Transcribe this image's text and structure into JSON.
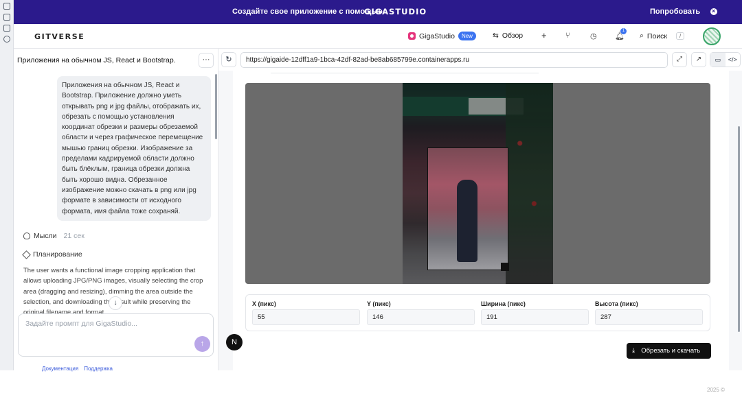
{
  "banner": {
    "message": "Создайте свое приложение с помощью",
    "brand": "GIGASTUDIO",
    "cta": "Попробовать"
  },
  "header": {
    "logo": "GITVERSE",
    "gigastudio": "GigaStudio",
    "new_badge": "New",
    "overview": "Обзор",
    "search": "Поиск",
    "search_shortcut": "/",
    "notifications_count": "1"
  },
  "chat": {
    "title": "Приложения на обычном JS, React и Bootstrap.",
    "user_message": "Приложения на обычном JS, React и Bootstrap. Приложение должно уметь открывать png и jpg файлы, отображать их, обрезать с помощью установления координат обрезки и размеры обрезаемой области и через графическое перемещение мышью границ обрезки. Изображение за пределами кадрируемой области должно быть блёклым, граница обрезки должна быть хорошо видна. Обрезанное изображение можно скачать в png или jpg формате в зависимости от исходного формата, имя файла тоже сохраняй.",
    "thoughts_label": "Мысли",
    "thoughts_time": "21 сек",
    "planning_label": "Планирование",
    "planning_text": "The user wants a functional image cropping application that allows uploading JPG/PNG images, visually selecting the crop area (dragging and resizing), dimming the area outside the selection, and downloading the result while preserving the original filename and format.",
    "prompt_placeholder": "Задайте промпт для GigaStudio...",
    "footer_docs": "Документация",
    "footer_support": "Поддержка"
  },
  "preview": {
    "url": "https://gigaide-12dff1a9-1bca-42df-82ad-be8ab685799e.containerapps.ru"
  },
  "app": {
    "fields": [
      {
        "label": "X (пикс)",
        "value": "55"
      },
      {
        "label": "Y (пикс)",
        "value": "146"
      },
      {
        "label": "Ширина (пикс)",
        "value": "191"
      },
      {
        "label": "Высота (пикс)",
        "value": "287"
      }
    ],
    "download_label": "Обрезать и скачать",
    "copyright": "2025 ©"
  },
  "fab": {
    "label": "N"
  },
  "colors": {
    "banner_bg": "#2b1a8c",
    "accent_blue": "#3b73f0",
    "gigastudio_pink": "#e5367d"
  }
}
